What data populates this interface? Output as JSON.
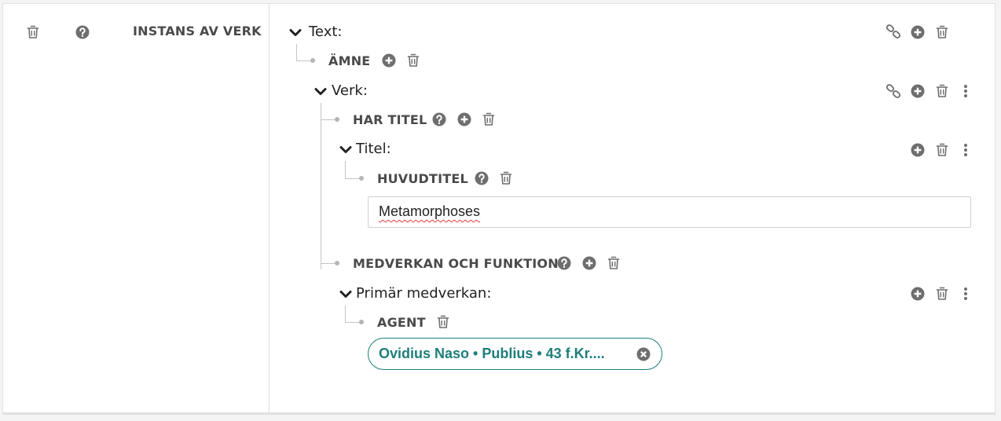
{
  "row": {
    "property_label": "INSTANS AV VERK"
  },
  "tree": {
    "text_entity": "Text:",
    "amne_label": "ÄMNE",
    "verk_entity": "Verk:",
    "har_titel_label": "HAR TITEL",
    "titel_entity": "Titel:",
    "huvudtitel_label": "HUVUDTITEL",
    "huvudtitel_value": "Metamorphoses",
    "medverkan_label": "MEDVERKAN OCH FUNKTION",
    "primar_entity": "Primär medverkan:",
    "agent_label": "AGENT",
    "agent_chip": "Ovidius Naso • Publius • 43 f.Kr...."
  },
  "icons": {
    "delete": "trash-icon",
    "help": "question-circle-icon",
    "add": "plus-circle-icon",
    "link": "link-icon",
    "more": "vertical-dots-icon",
    "collapse": "chevron-down-icon",
    "remove_chip": "times-circle-icon"
  },
  "colors": {
    "icon": "#6e6e6e",
    "chip_accent": "#1e7d7a",
    "tree_line": "#c4c4c4"
  }
}
